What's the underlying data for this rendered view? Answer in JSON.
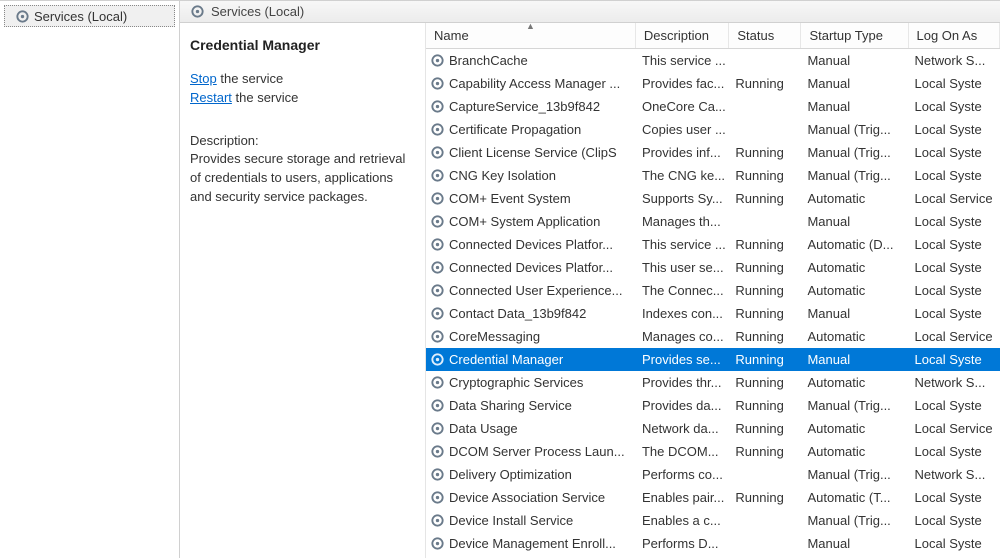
{
  "tree": {
    "node_label": "Services (Local)"
  },
  "pane_header": "Services (Local)",
  "detail": {
    "title": "Credential Manager",
    "action_stop_link": "Stop",
    "action_stop_rest": " the service",
    "action_restart_link": "Restart",
    "action_restart_rest": " the service",
    "description_heading": "Description:",
    "description_body": "Provides secure storage and retrieval of credentials to users, applications and security service packages."
  },
  "columns": {
    "name": "Name",
    "description": "Description",
    "status": "Status",
    "startup": "Startup Type",
    "logon": "Log On As"
  },
  "rows": [
    {
      "name": "BranchCache",
      "desc": "This service ...",
      "status": "",
      "startup": "Manual",
      "logon": "Network S...",
      "selected": false
    },
    {
      "name": "Capability Access Manager ...",
      "desc": "Provides fac...",
      "status": "Running",
      "startup": "Manual",
      "logon": "Local Syste",
      "selected": false
    },
    {
      "name": "CaptureService_13b9f842",
      "desc": "OneCore Ca...",
      "status": "",
      "startup": "Manual",
      "logon": "Local Syste",
      "selected": false
    },
    {
      "name": "Certificate Propagation",
      "desc": "Copies user ...",
      "status": "",
      "startup": "Manual (Trig...",
      "logon": "Local Syste",
      "selected": false
    },
    {
      "name": "Client License Service (ClipS",
      "desc": "Provides inf...",
      "status": "Running",
      "startup": "Manual (Trig...",
      "logon": "Local Syste",
      "selected": false
    },
    {
      "name": "CNG Key Isolation",
      "desc": "The CNG ke...",
      "status": "Running",
      "startup": "Manual (Trig...",
      "logon": "Local Syste",
      "selected": false
    },
    {
      "name": "COM+ Event System",
      "desc": "Supports Sy...",
      "status": "Running",
      "startup": "Automatic",
      "logon": "Local Service",
      "selected": false
    },
    {
      "name": "COM+ System Application",
      "desc": "Manages th...",
      "status": "",
      "startup": "Manual",
      "logon": "Local Syste",
      "selected": false
    },
    {
      "name": "Connected Devices Platfor...",
      "desc": "This service ...",
      "status": "Running",
      "startup": "Automatic (D...",
      "logon": "Local Syste",
      "selected": false
    },
    {
      "name": "Connected Devices Platfor...",
      "desc": "This user se...",
      "status": "Running",
      "startup": "Automatic",
      "logon": "Local Syste",
      "selected": false
    },
    {
      "name": "Connected User Experience...",
      "desc": "The Connec...",
      "status": "Running",
      "startup": "Automatic",
      "logon": "Local Syste",
      "selected": false
    },
    {
      "name": "Contact Data_13b9f842",
      "desc": "Indexes con...",
      "status": "Running",
      "startup": "Manual",
      "logon": "Local Syste",
      "selected": false
    },
    {
      "name": "CoreMessaging",
      "desc": "Manages co...",
      "status": "Running",
      "startup": "Automatic",
      "logon": "Local Service",
      "selected": false
    },
    {
      "name": "Credential Manager",
      "desc": "Provides se...",
      "status": "Running",
      "startup": "Manual",
      "logon": "Local Syste",
      "selected": true
    },
    {
      "name": "Cryptographic Services",
      "desc": "Provides thr...",
      "status": "Running",
      "startup": "Automatic",
      "logon": "Network S...",
      "selected": false
    },
    {
      "name": "Data Sharing Service",
      "desc": "Provides da...",
      "status": "Running",
      "startup": "Manual (Trig...",
      "logon": "Local Syste",
      "selected": false
    },
    {
      "name": "Data Usage",
      "desc": "Network da...",
      "status": "Running",
      "startup": "Automatic",
      "logon": "Local Service",
      "selected": false
    },
    {
      "name": "DCOM Server Process Laun...",
      "desc": "The DCOM...",
      "status": "Running",
      "startup": "Automatic",
      "logon": "Local Syste",
      "selected": false
    },
    {
      "name": "Delivery Optimization",
      "desc": "Performs co...",
      "status": "",
      "startup": "Manual (Trig...",
      "logon": "Network S...",
      "selected": false
    },
    {
      "name": "Device Association Service",
      "desc": "Enables pair...",
      "status": "Running",
      "startup": "Automatic (T...",
      "logon": "Local Syste",
      "selected": false
    },
    {
      "name": "Device Install Service",
      "desc": "Enables a c...",
      "status": "",
      "startup": "Manual (Trig...",
      "logon": "Local Syste",
      "selected": false
    },
    {
      "name": "Device Management Enroll...",
      "desc": "Performs D...",
      "status": "",
      "startup": "Manual",
      "logon": "Local Syste",
      "selected": false
    }
  ]
}
